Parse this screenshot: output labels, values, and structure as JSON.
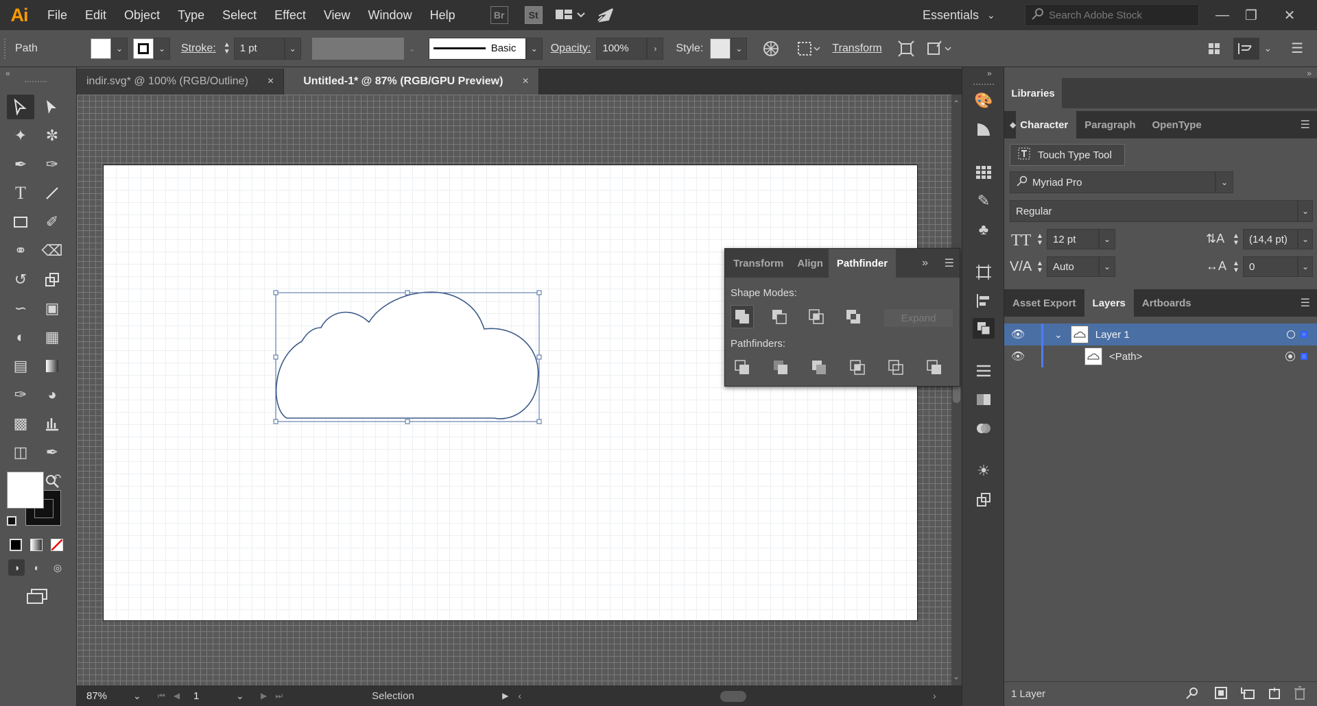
{
  "menubar": {
    "logo": "Ai",
    "items": [
      "File",
      "Edit",
      "Object",
      "Type",
      "Select",
      "Effect",
      "View",
      "Window",
      "Help"
    ],
    "bridge": "Br",
    "stock_app": "St",
    "workspace": "Essentials",
    "search_placeholder": "Search Adobe Stock"
  },
  "control": {
    "selection_type": "Path",
    "stroke_label": "Stroke:",
    "stroke_weight": "1 pt",
    "brush": "Basic",
    "opacity_label": "Opacity:",
    "opacity_value": "100%",
    "style_label": "Style:",
    "transform_link": "Transform"
  },
  "tabs": [
    {
      "label": "indir.svg* @ 100% (RGB/Outline)",
      "close": "×"
    },
    {
      "label": "Untitled-1* @ 87% (RGB/GPU Preview)",
      "close": "×"
    }
  ],
  "status": {
    "zoom": "87%",
    "artboard_number": "1",
    "tool": "Selection"
  },
  "pathfinder": {
    "tabs": [
      "Transform",
      "Align",
      "Pathfinder"
    ],
    "shape_modes_label": "Shape Modes:",
    "pathfinders_label": "Pathfinders:",
    "expand_label": "Expand"
  },
  "libraries": {
    "tab": "Libraries"
  },
  "character": {
    "tabs": [
      "Character",
      "Paragraph",
      "OpenType"
    ],
    "touch_type": "Touch Type Tool",
    "font_family": "Myriad Pro",
    "font_style": "Regular",
    "font_size": "12 pt",
    "leading": "(14,4 pt)",
    "kerning": "Auto",
    "tracking": "0"
  },
  "layers": {
    "tabs": [
      "Asset Export",
      "Layers",
      "Artboards"
    ],
    "rows": [
      {
        "name": "Layer 1"
      },
      {
        "name": "<Path>"
      }
    ],
    "count": "1 Layer"
  },
  "colors": {
    "accent": "#4a6fa5",
    "layer_color": "#4f7bff",
    "selection": "#4a6b9c"
  }
}
